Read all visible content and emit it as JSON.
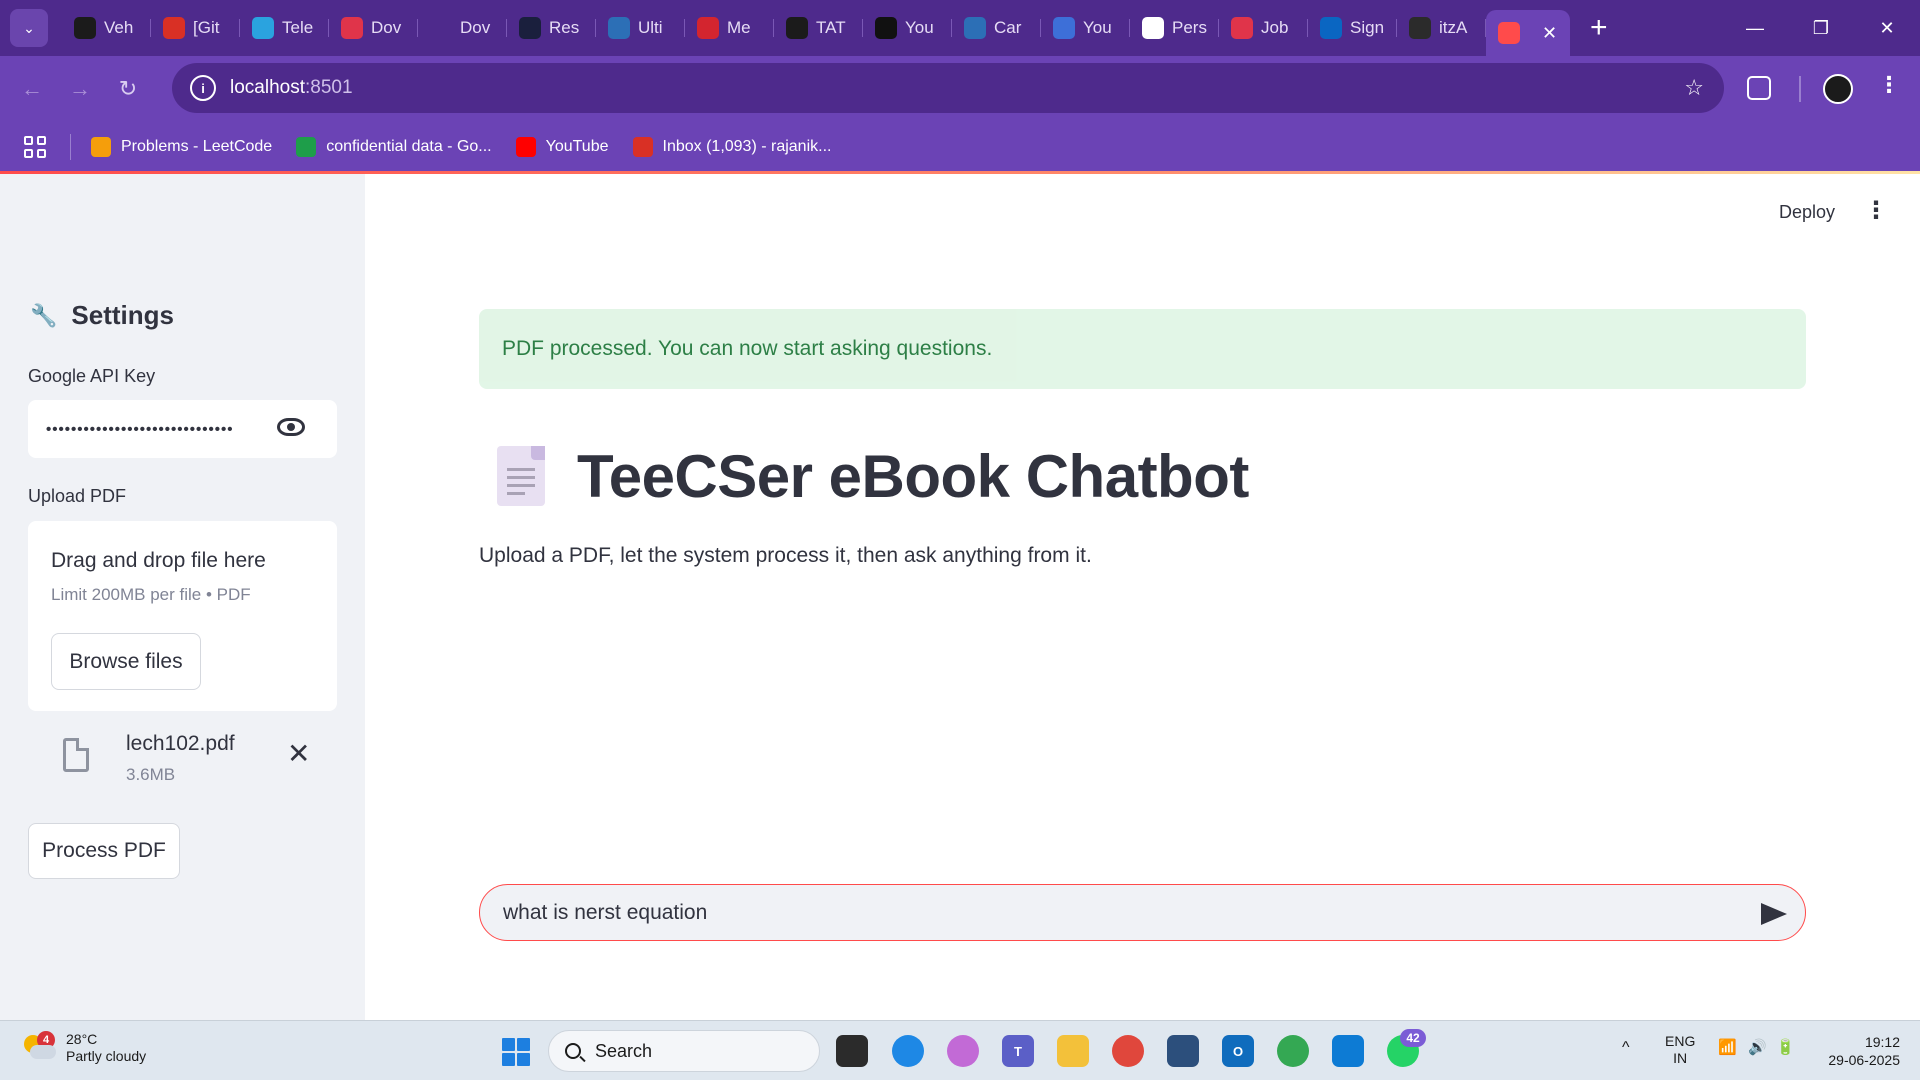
{
  "browser": {
    "tabs": [
      {
        "label": "Veh",
        "icon": "openai-icon",
        "color": "#1b1b1b"
      },
      {
        "label": "[Git",
        "icon": "gmail-icon",
        "color": "#d93025"
      },
      {
        "label": "Tele",
        "icon": "telegram-icon",
        "color": "#2aa3df"
      },
      {
        "label": "Dov",
        "icon": "heart-icon",
        "color": "#e0344a"
      },
      {
        "label": "Dov",
        "icon": "download-icon",
        "color": "#4e2a8c"
      },
      {
        "label": "Res",
        "icon": "resume-icon",
        "color": "#1a1f3d"
      },
      {
        "label": "Ulti",
        "icon": "tata-icon",
        "color": "#2c6fb6"
      },
      {
        "label": "Me",
        "icon": "mahindra-icon",
        "color": "#d3252f"
      },
      {
        "label": "TAT",
        "icon": "tcs-icon",
        "color": "#1b1b1b"
      },
      {
        "label": "You",
        "icon": "b-icon",
        "color": "#111111"
      },
      {
        "label": "Car",
        "icon": "sf-icon",
        "color": "#2c6fb6"
      },
      {
        "label": "You",
        "icon": "cube-icon",
        "color": "#3d6fd8"
      },
      {
        "label": "Pers",
        "icon": "page-icon",
        "color": "#ffffff"
      },
      {
        "label": "Job",
        "icon": "jobs-icon",
        "color": "#e0344a"
      },
      {
        "label": "Sign",
        "icon": "linkedin-icon",
        "color": "#0a66c2"
      },
      {
        "label": "itzA",
        "icon": "github-icon",
        "color": "#2b2b2b"
      }
    ],
    "active_tab_icon": "streamlit-icon",
    "close_glyph": "✕",
    "new_tab_glyph": "+",
    "url_host": "localhost",
    "url_port": ":8501",
    "bookmarks": [
      {
        "label": "Problems - LeetCode",
        "icon": "leetcode-icon",
        "color": "#f59e0b"
      },
      {
        "label": "confidential data - Go...",
        "icon": "sheets-icon",
        "color": "#1e9e4a"
      },
      {
        "label": "YouTube",
        "icon": "youtube-icon",
        "color": "#ff0000"
      },
      {
        "label": "Inbox (1,093) - rajanik...",
        "icon": "gmail-icon",
        "color": "#d93025"
      }
    ]
  },
  "app": {
    "header": {
      "deploy_label": "Deploy",
      "menu_glyph": "⋮"
    },
    "sidebar": {
      "title": "Settings",
      "title_icon": "wrench-icon",
      "api_key_label": "Google API Key",
      "api_key_masked": "••••••••••••••••••••••••••••••",
      "upload_label": "Upload PDF",
      "dropzone_title": "Drag and drop file here",
      "dropzone_limit": "Limit 200MB per file • PDF",
      "browse_label": "Browse files",
      "file_name": "lech102.pdf",
      "file_size": "3.6MB",
      "remove_glyph": "✕",
      "process_label": "Process PDF"
    },
    "main": {
      "alert_text": "PDF processed. You can now start asking questions.",
      "alert_color": "#177233",
      "title": "TeeCSer eBook Chatbot",
      "description": "Upload a PDF, let the system process it, then ask anything from it.",
      "chat_input_value": "what is nerst equation",
      "accent_color": "#ff4b4b"
    }
  },
  "taskbar": {
    "weather_temp": "28°C",
    "weather_condition": "Partly cloudy",
    "weather_badge": "4",
    "search_label": "Search",
    "whatsapp_badge": "42",
    "language": "ENG",
    "region": "IN",
    "time": "19:12",
    "date": "29-06-2025"
  }
}
